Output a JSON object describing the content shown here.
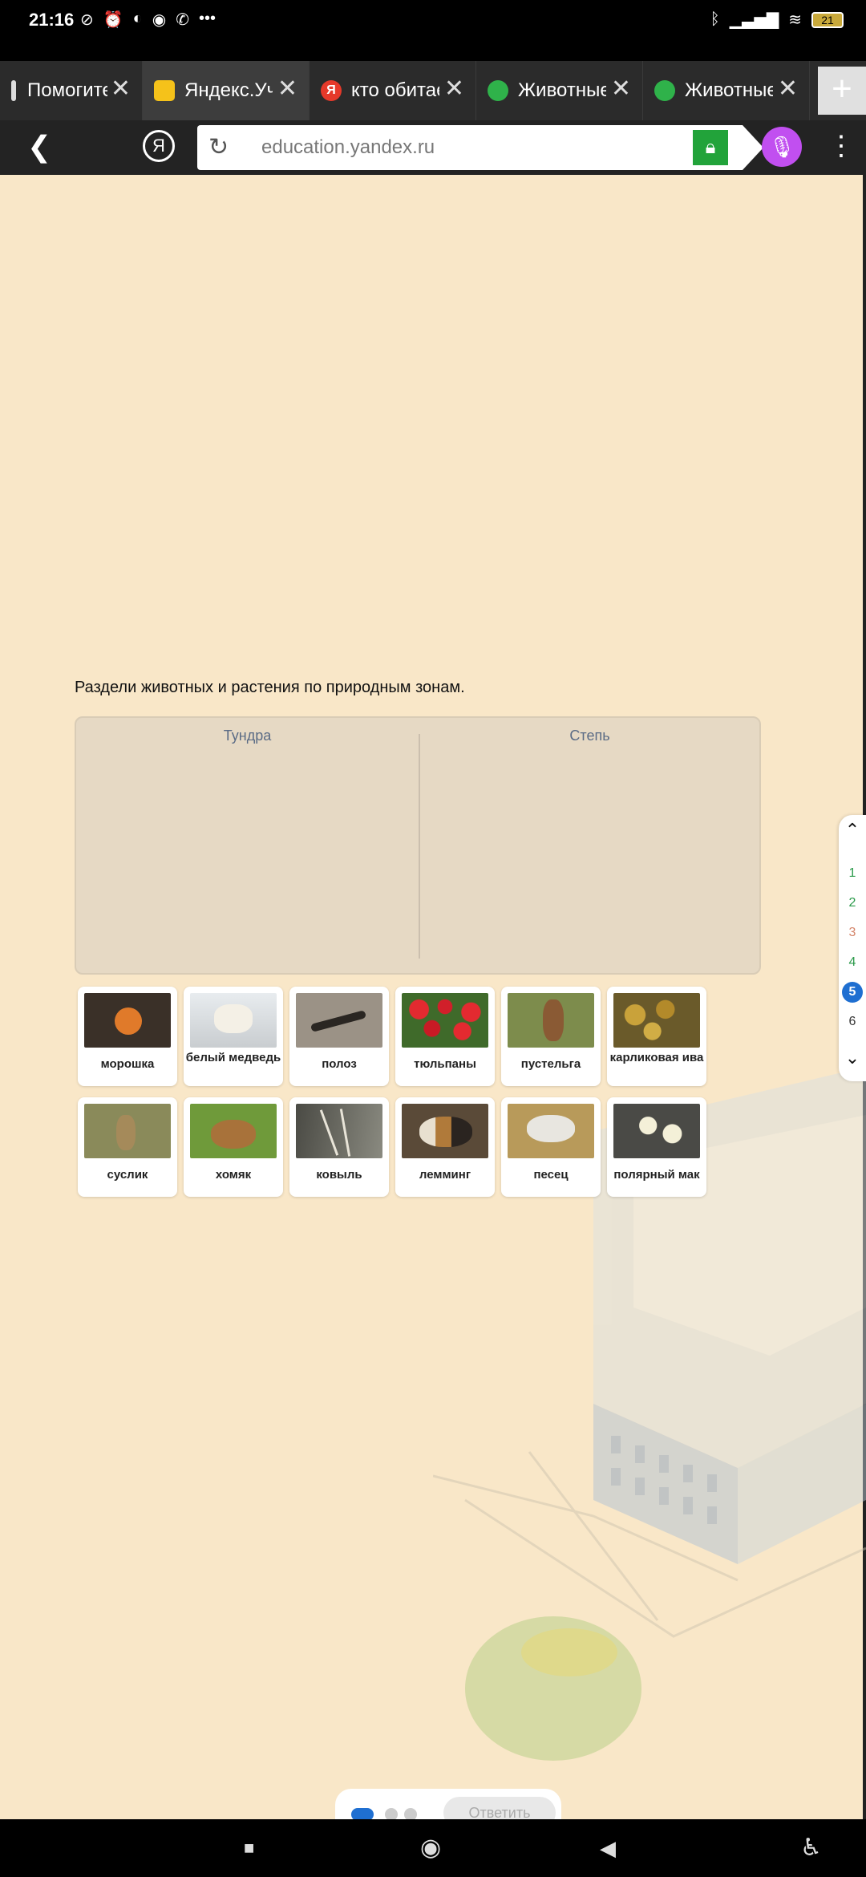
{
  "status_bar": {
    "time": "21:16",
    "battery": "21"
  },
  "tabs": [
    {
      "title": "Помогите",
      "favicon": "",
      "favicon_color": "#888888",
      "active": false
    },
    {
      "title": "Яндекс.Уч",
      "favicon": "",
      "favicon_color": "#f5c21a",
      "active": true
    },
    {
      "title": "кто обитает",
      "favicon": "Я",
      "favicon_color": "#e6392a",
      "active": false
    },
    {
      "title": "Животные",
      "favicon": "",
      "favicon_color": "#2fb24a",
      "active": false
    },
    {
      "title": "Животные",
      "favicon": "",
      "favicon_color": "#2fb24a",
      "active": false
    }
  ],
  "tab_add_label": "+",
  "address_bar": {
    "yandex_label": "Я",
    "url": "education.yandex.ru"
  },
  "task": {
    "instruction": "Раздели животных и растения по природным зонам.",
    "zones": [
      "Тундра",
      "Степь"
    ],
    "cards": [
      {
        "label": "морошка",
        "image_color": "#b5622a"
      },
      {
        "label": "белый медведь",
        "image_color": "#d9d5cc"
      },
      {
        "label": "полоз",
        "image_color": "#8a7f72"
      },
      {
        "label": "тюльпаны",
        "image_color": "#c9202a"
      },
      {
        "label": "пустельга",
        "image_color": "#7a8a4a"
      },
      {
        "label": "карликовая ива",
        "image_color": "#b08a2a"
      },
      {
        "label": "суслик",
        "image_color": "#8a8a5a"
      },
      {
        "label": "хомяк",
        "image_color": "#6f8a3a"
      },
      {
        "label": "ковыль",
        "image_color": "#6a6a60"
      },
      {
        "label": "лемминг",
        "image_color": "#6a5a45"
      },
      {
        "label": "песец",
        "image_color": "#b8a98a"
      },
      {
        "label": "полярный мак",
        "image_color": "#5a5a55"
      }
    ]
  },
  "question_nav": {
    "numbers": [
      "1",
      "2",
      "3",
      "4",
      "5",
      "6"
    ],
    "current": "5",
    "number_colors": [
      "#2a9a4a",
      "#2a9a4a",
      "#d4856a",
      "#2a9a4a",
      "#ffffff",
      "#333333"
    ]
  },
  "pager": {
    "answer_button": "Ответить"
  },
  "colors": {
    "page_bg": "#f9e7c8",
    "accent": "#1f6fd1",
    "drop_area": "#e6d9c4"
  }
}
